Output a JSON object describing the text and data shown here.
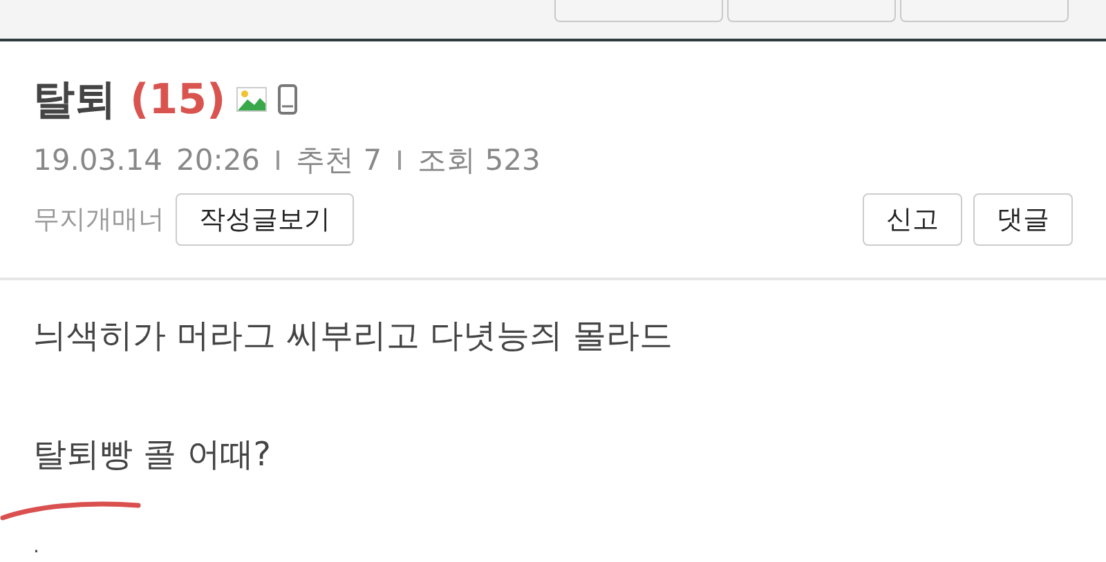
{
  "top_bar": {
    "buttons": [
      {
        "kind": "blank"
      },
      {
        "kind": "blank"
      },
      {
        "kind": "blank"
      }
    ]
  },
  "post": {
    "title": "탈퇴",
    "comment_count": "(15)",
    "has_image": true,
    "from_mobile": true,
    "date": "19.03.14",
    "time": "20:26",
    "recommend": "추천 7",
    "views": "조회 523",
    "author": "무지개매너",
    "author_posts_button": "작성글보기",
    "actions": [
      "신고",
      "댓글"
    ]
  },
  "body": {
    "paragraphs": [
      "늬색히가 머라그 씨부리고 다녓능즤 몰라드",
      "탈퇴빵 콜 어때?",
      "."
    ]
  }
}
